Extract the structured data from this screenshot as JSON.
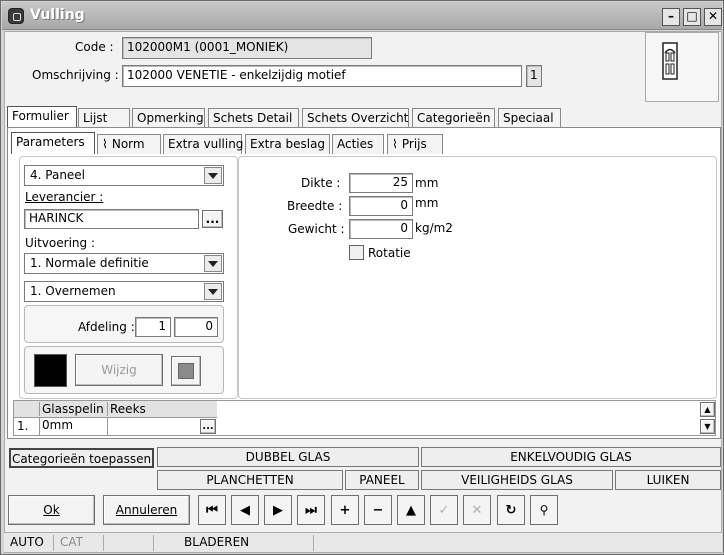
{
  "window": {
    "title": "Vulling"
  },
  "header": {
    "code_label": "Code :",
    "code_value": "102000M1 (0001_MONIEK)",
    "omschrijving_label": "Omschrijving :",
    "omschrijving_value": "102000 VENETIE - enkelzijdig motief",
    "omschrijving_count": "1"
  },
  "main_tabs": [
    "Formulier",
    "Lijst",
    "Opmerking",
    "Schets Detail",
    "Schets Overzicht",
    "Categorieën",
    "Speciaal"
  ],
  "sub_tabs": [
    "Parameters",
    "Norm",
    "Extra vulling",
    "Extra beslag",
    "Acties",
    "Prijs"
  ],
  "left": {
    "type_combo": "4.  Paneel",
    "leverancier_label": "Leverancier :",
    "leverancier_value": "HARINCK",
    "browse_btn": "...",
    "uitvoering_label": "Uitvoering :",
    "uitvoering_combo": "1.  Normale definitie",
    "overnemen_combo": "1.  Overnemen",
    "afdeling_label": "Afdeling :",
    "afdeling_from": "1",
    "afdeling_to": "0",
    "wijzig_btn": "Wijzig"
  },
  "right": {
    "dikte_label": "Dikte :",
    "dikte_value": "25",
    "dikte_unit": "mm",
    "breedte_label": "Breedte :",
    "breedte_value": "0",
    "breedte_unit": "mm",
    "gewicht_label": "Gewicht :",
    "gewicht_value": "0",
    "gewicht_unit": "kg/m2",
    "rotatie_label": "Rotatie"
  },
  "grid": {
    "headers": [
      "Glasspelin",
      "Reeks"
    ],
    "rows": [
      {
        "index": "1.",
        "glasspelin": "0mm",
        "reeks": ""
      }
    ],
    "cell_btn": "..."
  },
  "categories": {
    "apply_btn": "Categorieën toepassen",
    "row1": [
      "DUBBEL GLAS",
      "ENKELVOUDIG GLAS"
    ],
    "row2": [
      "PLANCHETTEN",
      "PANEEL",
      "VEILIGHEIDS GLAS",
      "LUIKEN"
    ]
  },
  "footer": {
    "ok_btn": "Ok",
    "cancel_btn": "Annuleren"
  },
  "status": {
    "mode1": "AUTO",
    "mode2": "CAT",
    "mode3": "BLADEREN"
  }
}
